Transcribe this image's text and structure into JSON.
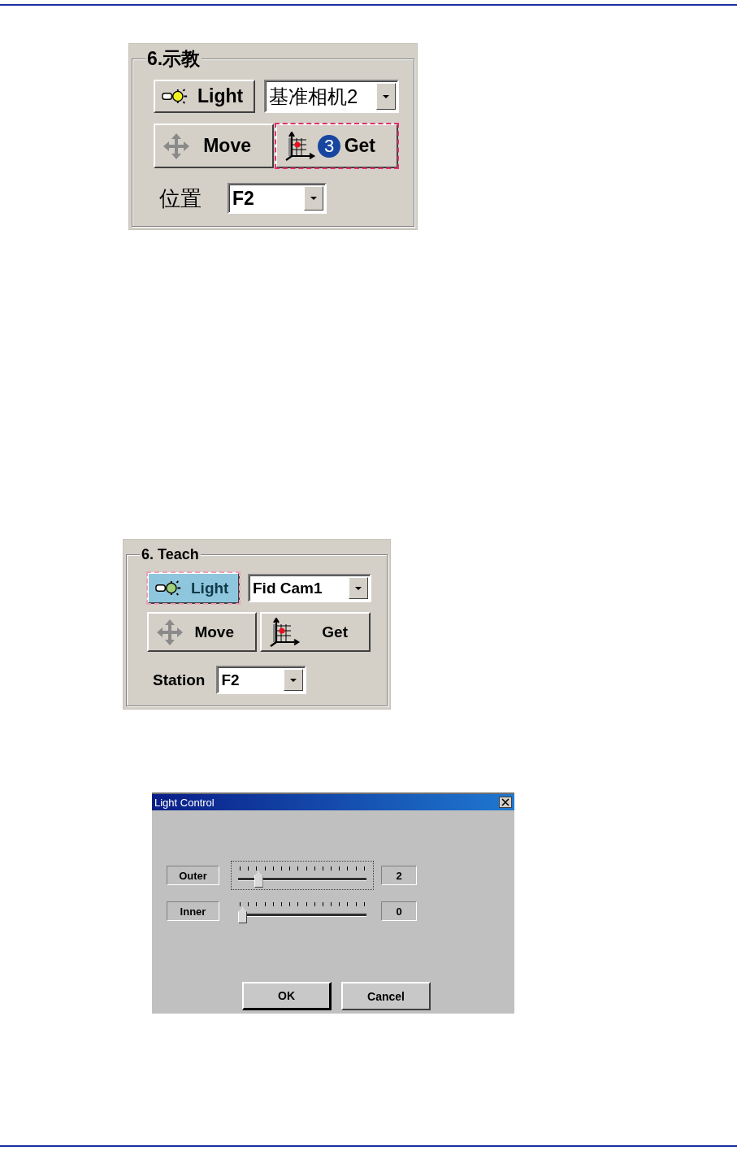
{
  "panels": [
    {
      "legend": "6.示教",
      "light": {
        "label": "Light",
        "selected": false,
        "highlighted": false
      },
      "camera": {
        "value": "基准相机2"
      },
      "move": {
        "label": "Move",
        "selected": false,
        "highlighted": false
      },
      "get": {
        "label": "Get",
        "selected": false,
        "highlighted": true,
        "badge": "3"
      },
      "station": {
        "label": "位置",
        "value": "F2"
      }
    },
    {
      "legend": "6. Teach",
      "light": {
        "label": "Light",
        "selected": true,
        "highlighted": true
      },
      "camera": {
        "value": "Fid Cam1"
      },
      "move": {
        "label": "Move",
        "selected": false,
        "highlighted": false
      },
      "get": {
        "label": "Get",
        "selected": false,
        "highlighted": false
      },
      "station": {
        "label": "Station",
        "value": "F2"
      }
    }
  ],
  "dialog": {
    "title": "Light Control",
    "sliders": [
      {
        "name": "Outer",
        "level": 0.13,
        "reading": "2",
        "focused": true
      },
      {
        "name": "Inner",
        "level": 0,
        "reading": "0",
        "focused": false
      }
    ],
    "buttons": [
      {
        "label": "OK",
        "default": true
      },
      {
        "label": "Cancel",
        "default": false
      }
    ]
  }
}
